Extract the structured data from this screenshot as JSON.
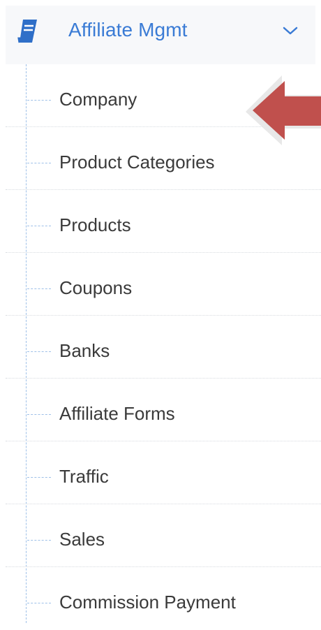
{
  "header": {
    "title": "Affiliate Mgmt",
    "icon": "book-icon",
    "expand_icon": "chevron-down-icon",
    "accent_color": "#3a7bd5"
  },
  "menu": {
    "items": [
      {
        "label": "Company"
      },
      {
        "label": "Product Categories"
      },
      {
        "label": "Products"
      },
      {
        "label": "Coupons"
      },
      {
        "label": "Banks"
      },
      {
        "label": "Affiliate Forms"
      },
      {
        "label": "Traffic"
      },
      {
        "label": "Sales"
      },
      {
        "label": "Commission Payment"
      }
    ]
  },
  "annotation": {
    "icon": "pointer-arrow-icon",
    "color": "#c0504d"
  }
}
